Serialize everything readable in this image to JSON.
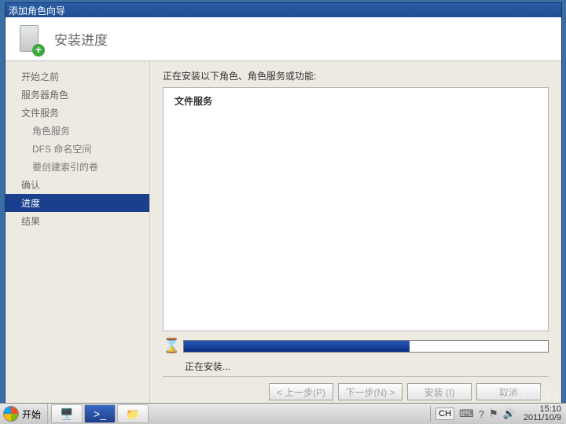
{
  "window": {
    "title": "添加角色向导"
  },
  "header": {
    "page_title": "安装进度"
  },
  "sidebar": {
    "items": [
      {
        "label": "开始之前",
        "sub": false,
        "active": false
      },
      {
        "label": "服务器角色",
        "sub": false,
        "active": false
      },
      {
        "label": "文件服务",
        "sub": false,
        "active": false
      },
      {
        "label": "角色服务",
        "sub": true,
        "active": false
      },
      {
        "label": "DFS 命名空间",
        "sub": true,
        "active": false
      },
      {
        "label": "要创建索引的卷",
        "sub": true,
        "active": false
      },
      {
        "label": "确认",
        "sub": false,
        "active": false
      },
      {
        "label": "进度",
        "sub": false,
        "active": true
      },
      {
        "label": "结果",
        "sub": false,
        "active": false
      }
    ]
  },
  "content": {
    "installing_label": "正在安装以下角色、角色服务或功能:",
    "roles": [
      "文件服务"
    ],
    "progress_percent": 62,
    "status_text": "正在安装..."
  },
  "buttons": {
    "prev": "< 上一步(P)",
    "next": "下一步(N) >",
    "install": "安装 (I)",
    "cancel": "取消"
  },
  "taskbar": {
    "start_label": "开始",
    "lang": "CH",
    "time": "15:10",
    "date": "2011/10/9"
  },
  "watermark": "51CTO"
}
